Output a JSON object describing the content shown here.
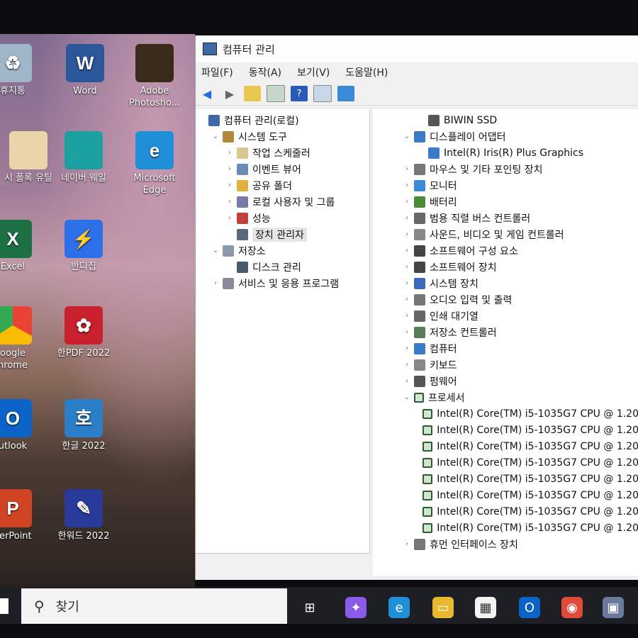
{
  "desktop": {
    "icons": [
      {
        "label": "휴지통",
        "color": "#9fb6c8",
        "glyph": "♻"
      },
      {
        "label": "Word",
        "color": "#2b579a",
        "glyph": "W"
      },
      {
        "label": "Adobe Photosho...",
        "color": "#3a2a1a",
        "glyph": ""
      },
      {
        "label": "시 폴록 유틸",
        "color": "#e8d6a8",
        "glyph": ""
      },
      {
        "label": "네이버 웨일",
        "color": "#1aa0a0",
        "glyph": ""
      },
      {
        "label": "Microsoft Edge",
        "color": "#1f8fd8",
        "glyph": "e"
      },
      {
        "label": "Excel",
        "color": "#1d7044",
        "glyph": "X"
      },
      {
        "label": "반디집",
        "color": "#2d6fe8",
        "glyph": "⚡"
      },
      {
        "label": "oogle hrome",
        "color": "#ffffff",
        "glyph": ""
      },
      {
        "label": "한PDF 2022",
        "color": "#c8202c",
        "glyph": "✿"
      },
      {
        "label": "utlook",
        "color": "#0a64c8",
        "glyph": "O"
      },
      {
        "label": "한글 2022",
        "color": "#2a7fc8",
        "glyph": "호"
      },
      {
        "label": "verPoint",
        "color": "#d04423",
        "glyph": "P"
      },
      {
        "label": "한워드 2022",
        "color": "#2a3a9a",
        "glyph": "✎"
      }
    ]
  },
  "window": {
    "title": "컴퓨터 관리",
    "menu": [
      "파일(F)",
      "동작(A)",
      "보기(V)",
      "도움말(H)"
    ]
  },
  "tree": [
    {
      "label": "컴퓨터 관리(로컬)",
      "indent": 0,
      "chev": "",
      "icon": "#3c6aa8"
    },
    {
      "label": "시스템 도구",
      "indent": 1,
      "chev": "⌄",
      "icon": "#b08a3a"
    },
    {
      "label": "작업 스케줄러",
      "indent": 2,
      "chev": "›",
      "icon": "#d8c890"
    },
    {
      "label": "이벤트 뷰어",
      "indent": 2,
      "chev": "›",
      "icon": "#6a8ab8"
    },
    {
      "label": "공유 폴더",
      "indent": 2,
      "chev": "›",
      "icon": "#e0b040"
    },
    {
      "label": "로컬 사용자 및 그룹",
      "indent": 2,
      "chev": "›",
      "icon": "#7a7aa8"
    },
    {
      "label": "성능",
      "indent": 2,
      "chev": "›",
      "icon": "#c04040"
    },
    {
      "label": "장치 관리자",
      "indent": 2,
      "chev": "",
      "icon": "#5a6a7a",
      "selected": true
    },
    {
      "label": "저장소",
      "indent": 1,
      "chev": "⌄",
      "icon": "#8a9aa8"
    },
    {
      "label": "디스크 관리",
      "indent": 2,
      "chev": "",
      "icon": "#4a5a6a"
    },
    {
      "label": "서비스 및 응용 프로그램",
      "indent": 1,
      "chev": "›",
      "icon": "#8a8a9a"
    }
  ],
  "devices": [
    {
      "label": "BIWIN SSD",
      "indent": 2,
      "chev": "",
      "icon": "#555"
    },
    {
      "label": "디스플레이 어댑터",
      "indent": 1,
      "chev": "⌄",
      "icon": "#3a7ac8"
    },
    {
      "label": "Intel(R) Iris(R) Plus Graphics",
      "indent": 2,
      "chev": "",
      "icon": "#3a7ac8"
    },
    {
      "label": "마우스 및 기타 포인팅 장치",
      "indent": 1,
      "chev": "›",
      "icon": "#777"
    },
    {
      "label": "모니터",
      "indent": 1,
      "chev": "›",
      "icon": "#3a8ad8"
    },
    {
      "label": "배터리",
      "indent": 1,
      "chev": "›",
      "icon": "#4a8a3a"
    },
    {
      "label": "범용 직렬 버스 컨트롤러",
      "indent": 1,
      "chev": "›",
      "icon": "#666"
    },
    {
      "label": "사운드, 비디오 및 게임 컨트롤러",
      "indent": 1,
      "chev": "›",
      "icon": "#888"
    },
    {
      "label": "소프트웨어 구성 요소",
      "indent": 1,
      "chev": "›",
      "icon": "#444"
    },
    {
      "label": "소프트웨어 장치",
      "indent": 1,
      "chev": "›",
      "icon": "#444"
    },
    {
      "label": "시스템 장치",
      "indent": 1,
      "chev": "›",
      "icon": "#3a6ab8"
    },
    {
      "label": "오디오 입력 및 출력",
      "indent": 1,
      "chev": "›",
      "icon": "#777"
    },
    {
      "label": "인쇄 대기열",
      "indent": 1,
      "chev": "›",
      "icon": "#666"
    },
    {
      "label": "저장소 컨트롤러",
      "indent": 1,
      "chev": "›",
      "icon": "#5a7a5a"
    },
    {
      "label": "컴퓨터",
      "indent": 1,
      "chev": "›",
      "icon": "#3a7ac8"
    },
    {
      "label": "키보드",
      "indent": 1,
      "chev": "›",
      "icon": "#888"
    },
    {
      "label": "펌웨어",
      "indent": 1,
      "chev": "›",
      "icon": "#555"
    },
    {
      "label": "프로세서",
      "indent": 1,
      "chev": "⌄",
      "icon": "cpu"
    },
    {
      "label": "Intel(R) Core(TM) i5-1035G7 CPU @ 1.20",
      "indent": 2,
      "chev": "",
      "icon": "cpu"
    },
    {
      "label": "Intel(R) Core(TM) i5-1035G7 CPU @ 1.20",
      "indent": 2,
      "chev": "",
      "icon": "cpu"
    },
    {
      "label": "Intel(R) Core(TM) i5-1035G7 CPU @ 1.20",
      "indent": 2,
      "chev": "",
      "icon": "cpu"
    },
    {
      "label": "Intel(R) Core(TM) i5-1035G7 CPU @ 1.20",
      "indent": 2,
      "chev": "",
      "icon": "cpu"
    },
    {
      "label": "Intel(R) Core(TM) i5-1035G7 CPU @ 1.20",
      "indent": 2,
      "chev": "",
      "icon": "cpu"
    },
    {
      "label": "Intel(R) Core(TM) i5-1035G7 CPU @ 1.20",
      "indent": 2,
      "chev": "",
      "icon": "cpu"
    },
    {
      "label": "Intel(R) Core(TM) i5-1035G7 CPU @ 1.20",
      "indent": 2,
      "chev": "",
      "icon": "cpu"
    },
    {
      "label": "Intel(R) Core(TM) i5-1035G7 CPU @ 1.20",
      "indent": 2,
      "chev": "",
      "icon": "cpu"
    },
    {
      "label": "휴먼 인터페이스 장치",
      "indent": 1,
      "chev": "›",
      "icon": "#777"
    }
  ],
  "taskbar": {
    "search_placeholder": "찾기",
    "apps": [
      {
        "name": "task-view-icon",
        "color": "#1d1f24",
        "glyph": "⊞"
      },
      {
        "name": "copilot-icon",
        "color": "#8a5ae8",
        "glyph": "✦"
      },
      {
        "name": "edge-icon",
        "color": "#1f8fd8",
        "glyph": "e"
      },
      {
        "name": "file-explorer-icon",
        "color": "#e8b830",
        "glyph": "▭"
      },
      {
        "name": "store-icon",
        "color": "#f3f3f3",
        "glyph": "▦"
      },
      {
        "name": "outlook-icon",
        "color": "#0a64c8",
        "glyph": "O"
      },
      {
        "name": "chrome-icon",
        "color": "#e04a3a",
        "glyph": "◉"
      },
      {
        "name": "computer-management-icon",
        "color": "#6a7a9a",
        "glyph": "▣"
      }
    ]
  }
}
